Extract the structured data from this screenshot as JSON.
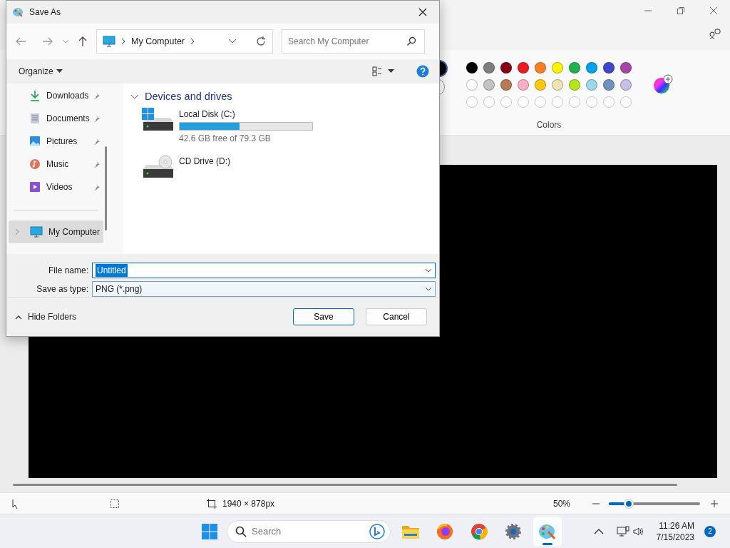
{
  "paint": {
    "colors_label": "Colors",
    "current_colors": [
      {
        "color": "#000000"
      },
      {
        "color": "#ffffff"
      }
    ],
    "palette": [
      {
        "color": "#000000"
      },
      {
        "color": "#7f7f7f"
      },
      {
        "color": "#880015"
      },
      {
        "color": "#ed1c24"
      },
      {
        "color": "#ff7f27"
      },
      {
        "color": "#fff200"
      },
      {
        "color": "#22b14c"
      },
      {
        "color": "#00a2e8"
      },
      {
        "color": "#3f48cc"
      },
      {
        "color": "#a349a4"
      },
      {
        "color": "#ffffff"
      },
      {
        "color": "#c3c3c3"
      },
      {
        "color": "#b97a57"
      },
      {
        "color": "#ffaec9"
      },
      {
        "color": "#ffc90e"
      },
      {
        "color": "#efe4b0"
      },
      {
        "color": "#b5e61d"
      },
      {
        "color": "#99d9ea"
      },
      {
        "color": "#7092be"
      },
      {
        "color": "#c8bfe7"
      }
    ],
    "status": {
      "canvas_size": "1940 × 878px",
      "zoom": "50%",
      "zoom_slider": {
        "level": 0.22
      }
    }
  },
  "dialog": {
    "title": "Save As",
    "path": "My Computer",
    "search": {
      "placeholder": "Search My Computer"
    },
    "organize": "Organize",
    "sidebar": [
      {
        "label": "Downloads",
        "kind": "downloads",
        "pinned": true,
        "selected": false
      },
      {
        "label": "Documents",
        "kind": "documents",
        "pinned": true,
        "selected": false
      },
      {
        "label": "Pictures",
        "kind": "pictures",
        "pinned": true,
        "selected": false
      },
      {
        "label": "Music",
        "kind": "music",
        "pinned": true,
        "selected": false
      },
      {
        "label": "Videos",
        "kind": "videos",
        "pinned": true,
        "selected": false
      },
      {
        "label": "My Computer",
        "kind": "computer",
        "pinned": false,
        "selected": true
      }
    ],
    "group": {
      "label": "Devices and drives",
      "expanded": true
    },
    "drives": [
      {
        "name": "Local Disk (C:)",
        "kind": "disk",
        "level": 0.45,
        "free": "42.6 GB free of 79.3 GB"
      },
      {
        "name": "CD Drive (D:)",
        "kind": "cd"
      }
    ],
    "file_name": {
      "label": "File name:",
      "value": "Untitled",
      "selected": true
    },
    "save_type": {
      "label": "Save as type:",
      "value": "PNG (*.png)"
    },
    "hide_folders": "Hide Folders",
    "buttons": [
      {
        "label": "Save",
        "default": true
      },
      {
        "label": "Cancel",
        "default": false
      }
    ]
  },
  "taskbar": {
    "search": {
      "placeholder": "Search"
    },
    "apps": [
      {
        "kind": "explorer",
        "active": false
      },
      {
        "kind": "firefox",
        "active": false
      },
      {
        "kind": "chrome",
        "active": false
      },
      {
        "kind": "settings",
        "active": false
      },
      {
        "kind": "paint",
        "active": true
      }
    ],
    "time": "11:26 AM",
    "date": "7/15/2023",
    "notifications": "2"
  }
}
